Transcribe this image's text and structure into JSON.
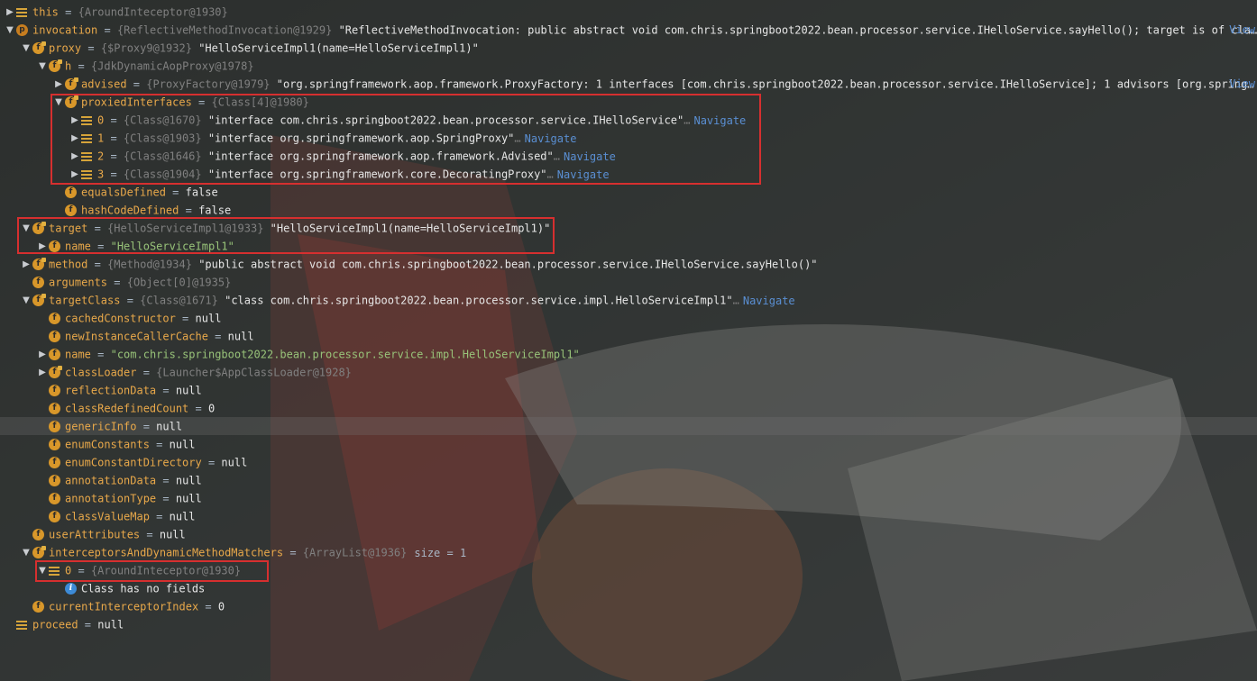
{
  "ui": {
    "view_label": "View",
    "navigate_label": "Navigate",
    "ellipsis": "…"
  },
  "rows": [
    {
      "indent": 0,
      "arrow": "collapsed",
      "icon": "list",
      "name": "this",
      "eq": " = ",
      "type": "{AroundInteceptor@1930}"
    },
    {
      "indent": 0,
      "arrow": "expanded",
      "icon": "p",
      "name": "invocation",
      "eq": " = ",
      "type": "{ReflectiveMethodInvocation@1929}",
      "value": " \"ReflectiveMethodInvocation: public abstract void com.chris.springboot2022.bean.processor.service.IHelloService.sayHello(); target is of cla…",
      "view": true
    },
    {
      "indent": 1,
      "arrow": "expanded",
      "icon": "f",
      "final": true,
      "name": "proxy",
      "eq": " = ",
      "type": "{$Proxy9@1932}",
      "value": " \"HelloServiceImpl1(name=HelloServiceImpl1)\""
    },
    {
      "indent": 2,
      "arrow": "expanded",
      "icon": "f",
      "final": true,
      "name": "h",
      "eq": " = ",
      "type": "{JdkDynamicAopProxy@1978}"
    },
    {
      "indent": 3,
      "arrow": "collapsed",
      "icon": "f",
      "final": true,
      "name": "advised",
      "eq": " = ",
      "type": "{ProxyFactory@1979}",
      "value": " \"org.springframework.aop.framework.ProxyFactory: 1 interfaces [com.chris.springboot2022.bean.processor.service.IHelloService]; 1 advisors [org.spring…",
      "view": true
    },
    {
      "indent": 3,
      "arrow": "expanded",
      "icon": "f",
      "final": true,
      "name": "proxiedInterfaces",
      "eq": " = ",
      "type": "{Class[4]@1980}"
    },
    {
      "indent": 4,
      "arrow": "collapsed",
      "icon": "list",
      "name": "0",
      "eq": " = ",
      "type": "{Class@1670}",
      "value": " \"interface com.chris.springboot2022.bean.processor.service.IHelloService\"",
      "navigate": true
    },
    {
      "indent": 4,
      "arrow": "collapsed",
      "icon": "list",
      "name": "1",
      "eq": " = ",
      "type": "{Class@1903}",
      "value": " \"interface org.springframework.aop.SpringProxy\"",
      "navigate": true
    },
    {
      "indent": 4,
      "arrow": "collapsed",
      "icon": "list",
      "name": "2",
      "eq": " = ",
      "type": "{Class@1646}",
      "value": " \"interface org.springframework.aop.framework.Advised\"",
      "navigate": true
    },
    {
      "indent": 4,
      "arrow": "collapsed",
      "icon": "list",
      "name": "3",
      "eq": " = ",
      "type": "{Class@1904}",
      "value": " \"interface org.springframework.core.DecoratingProxy\"",
      "navigate": true
    },
    {
      "indent": 3,
      "arrow": "none",
      "icon": "f",
      "name": "equalsDefined",
      "eq": " = ",
      "value": "false"
    },
    {
      "indent": 3,
      "arrow": "none",
      "icon": "f",
      "name": "hashCodeDefined",
      "eq": " = ",
      "value": "false"
    },
    {
      "indent": 1,
      "arrow": "expanded",
      "icon": "f",
      "final": true,
      "name": "target",
      "eq": " = ",
      "type": "{HelloServiceImpl1@1933}",
      "value": " \"HelloServiceImpl1(name=HelloServiceImpl1)\""
    },
    {
      "indent": 2,
      "arrow": "collapsed",
      "icon": "f",
      "name": "name",
      "eq": " = ",
      "str": "\"HelloServiceImpl1\""
    },
    {
      "indent": 1,
      "arrow": "collapsed",
      "icon": "f",
      "final": true,
      "name": "method",
      "eq": " = ",
      "type": "{Method@1934}",
      "value": " \"public abstract void com.chris.springboot2022.bean.processor.service.IHelloService.sayHello()\""
    },
    {
      "indent": 1,
      "arrow": "none",
      "icon": "f",
      "name": "arguments",
      "eq": " = ",
      "type": "{Object[0]@1935}"
    },
    {
      "indent": 1,
      "arrow": "expanded",
      "icon": "f",
      "final": true,
      "name": "targetClass",
      "eq": " = ",
      "type": "{Class@1671}",
      "value": " \"class com.chris.springboot2022.bean.processor.service.impl.HelloServiceImpl1\"",
      "navigate": true
    },
    {
      "indent": 2,
      "arrow": "none",
      "icon": "f",
      "name": "cachedConstructor",
      "eq": " = ",
      "value": "null"
    },
    {
      "indent": 2,
      "arrow": "none",
      "icon": "f",
      "name": "newInstanceCallerCache",
      "eq": " = ",
      "value": "null"
    },
    {
      "indent": 2,
      "arrow": "collapsed",
      "icon": "f",
      "name": "name",
      "eq": " = ",
      "str": "\"com.chris.springboot2022.bean.processor.service.impl.HelloServiceImpl1\""
    },
    {
      "indent": 2,
      "arrow": "collapsed",
      "icon": "f",
      "final": true,
      "name": "classLoader",
      "eq": " = ",
      "type": "{Launcher$AppClassLoader@1928}"
    },
    {
      "indent": 2,
      "arrow": "none",
      "icon": "f",
      "name": "reflectionData",
      "eq": " = ",
      "value": "null"
    },
    {
      "indent": 2,
      "arrow": "none",
      "icon": "f",
      "name": "classRedefinedCount",
      "eq": " = ",
      "value": "0"
    },
    {
      "indent": 2,
      "arrow": "none",
      "icon": "f",
      "name": "genericInfo",
      "eq": " = ",
      "value": "null",
      "selected": true
    },
    {
      "indent": 2,
      "arrow": "none",
      "icon": "f",
      "name": "enumConstants",
      "eq": " = ",
      "value": "null"
    },
    {
      "indent": 2,
      "arrow": "none",
      "icon": "f",
      "name": "enumConstantDirectory",
      "eq": " = ",
      "value": "null"
    },
    {
      "indent": 2,
      "arrow": "none",
      "icon": "f",
      "name": "annotationData",
      "eq": " = ",
      "value": "null"
    },
    {
      "indent": 2,
      "arrow": "none",
      "icon": "f",
      "name": "annotationType",
      "eq": " = ",
      "value": "null"
    },
    {
      "indent": 2,
      "arrow": "none",
      "icon": "f",
      "name": "classValueMap",
      "eq": " = ",
      "value": "null"
    },
    {
      "indent": 1,
      "arrow": "none",
      "icon": "f",
      "name": "userAttributes",
      "eq": " = ",
      "value": "null"
    },
    {
      "indent": 1,
      "arrow": "expanded",
      "icon": "f",
      "final": true,
      "name": "interceptorsAndDynamicMethodMatchers",
      "eq": " = ",
      "type": "{ArrayList@1936}",
      "size": "size = 1"
    },
    {
      "indent": 2,
      "arrow": "expanded",
      "icon": "list",
      "name": "0",
      "eq": " = ",
      "type": "{AroundInteceptor@1930}"
    },
    {
      "indent": 3,
      "arrow": "none",
      "icon": "info",
      "plain": "Class has no fields"
    },
    {
      "indent": 1,
      "arrow": "none",
      "icon": "f",
      "name": "currentInterceptorIndex",
      "eq": " = ",
      "value": "0"
    },
    {
      "indent": 0,
      "arrow": "none",
      "icon": "list",
      "name": "proceed",
      "eq": " = ",
      "value": "null"
    }
  ]
}
